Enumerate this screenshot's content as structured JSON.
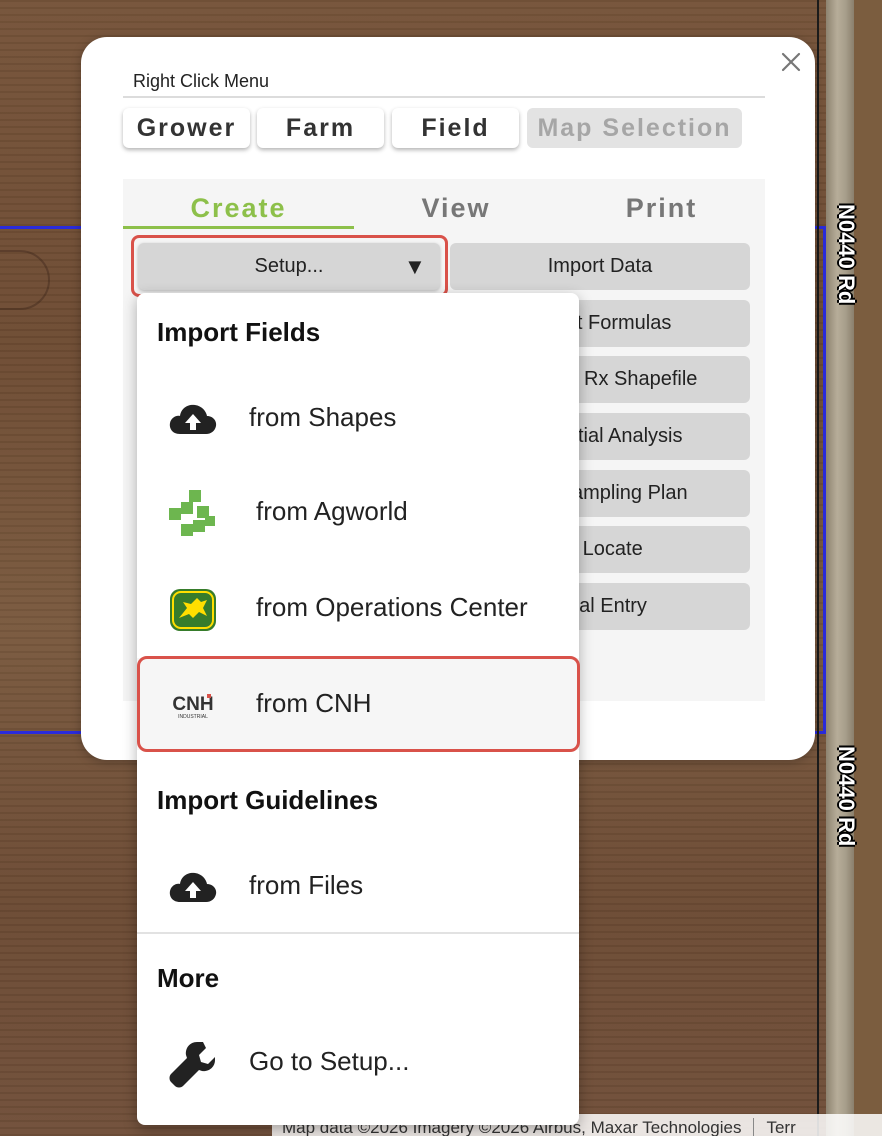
{
  "map": {
    "road_labels": [
      "N0440 Rd",
      "N0440 Rd"
    ],
    "attribution": "Map data ©2026 Imagery ©2026 Airbus, Maxar Technologies",
    "attribution_extra": "Terr"
  },
  "panel": {
    "title": "Right Click Menu",
    "scope_tabs": [
      "Grower",
      "Farm",
      "Field",
      "Map Selection"
    ],
    "mode_tabs": [
      "Create",
      "View",
      "Print"
    ],
    "setup_button": {
      "label": "Setup...",
      "caret": "▼"
    },
    "actions": {
      "import_data": "Import Data",
      "edit_formulas": "lit Formulas",
      "rx_shapefile": "Rx Shapefile",
      "spatial_analysis": "tial Analysis",
      "sampling_plan": "ampling Plan",
      "locate": "e Locate",
      "manual_entry": "ual Entry"
    }
  },
  "dropdown": {
    "import_fields_header": "Import Fields",
    "from_shapes": "from Shapes",
    "from_agworld": "from Agworld",
    "from_ops_center": "from Operations Center",
    "from_cnh": "from CNH",
    "import_guidelines_header": "Import Guidelines",
    "from_files": "from Files",
    "more_header": "More",
    "go_to_setup": "Go to Setup...",
    "cnh_logo_text": "CNH",
    "cnh_logo_subtext": "INDUSTRIAL"
  },
  "colors": {
    "accent_green": "#8dc04a",
    "highlight_red": "#d9524a",
    "field_boundary_blue": "#2a2bdc"
  }
}
